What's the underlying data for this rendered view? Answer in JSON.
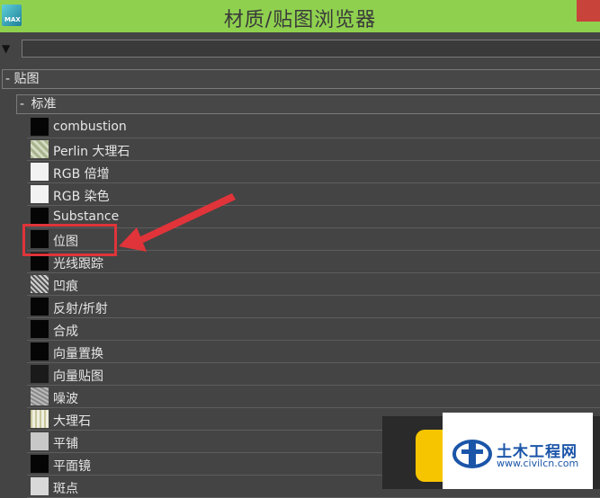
{
  "window": {
    "title": "材质/贴图浏览器",
    "logo_text": "MAX"
  },
  "filter": {
    "value": ""
  },
  "tree": {
    "group": {
      "toggle": "-",
      "label": "贴图"
    },
    "subgroup": {
      "toggle": "-",
      "label": "标准"
    },
    "items": [
      {
        "label": "combustion",
        "icon": "black-swatch-icon"
      },
      {
        "label": "Perlin 大理石",
        "icon": "perlin-marble-swatch-icon"
      },
      {
        "label": "RGB 倍增",
        "icon": "white-swatch-icon"
      },
      {
        "label": "RGB 染色",
        "icon": "white-swatch-icon"
      },
      {
        "label": "Substance",
        "icon": "black-swatch-icon"
      },
      {
        "label": "位图",
        "icon": "black-swatch-icon"
      },
      {
        "label": "光线跟踪",
        "icon": "black-swatch-icon"
      },
      {
        "label": "凹痕",
        "icon": "dent-swatch-icon"
      },
      {
        "label": "反射/折射",
        "icon": "black-swatch-icon"
      },
      {
        "label": "合成",
        "icon": "black-swatch-icon"
      },
      {
        "label": "向量置换",
        "icon": "black-swatch-icon"
      },
      {
        "label": "向量贴图",
        "icon": "vector-map-swatch-icon"
      },
      {
        "label": "噪波",
        "icon": "noise-swatch-icon"
      },
      {
        "label": "大理石",
        "icon": "marble-swatch-icon"
      },
      {
        "label": "平铺",
        "icon": "tile-swatch-icon"
      },
      {
        "label": "平面镜",
        "icon": "black-swatch-icon"
      },
      {
        "label": "斑点",
        "icon": "speckle-swatch-icon"
      }
    ]
  },
  "annotation": {
    "highlight_color": "#e0343a",
    "highlighted_item": "位图"
  },
  "watermark": {
    "name": "土木工程网",
    "url": "www.civilcn.com"
  },
  "colors": {
    "titlebar": "#8fd14f",
    "panel": "#444444",
    "close": "#c8443a"
  }
}
